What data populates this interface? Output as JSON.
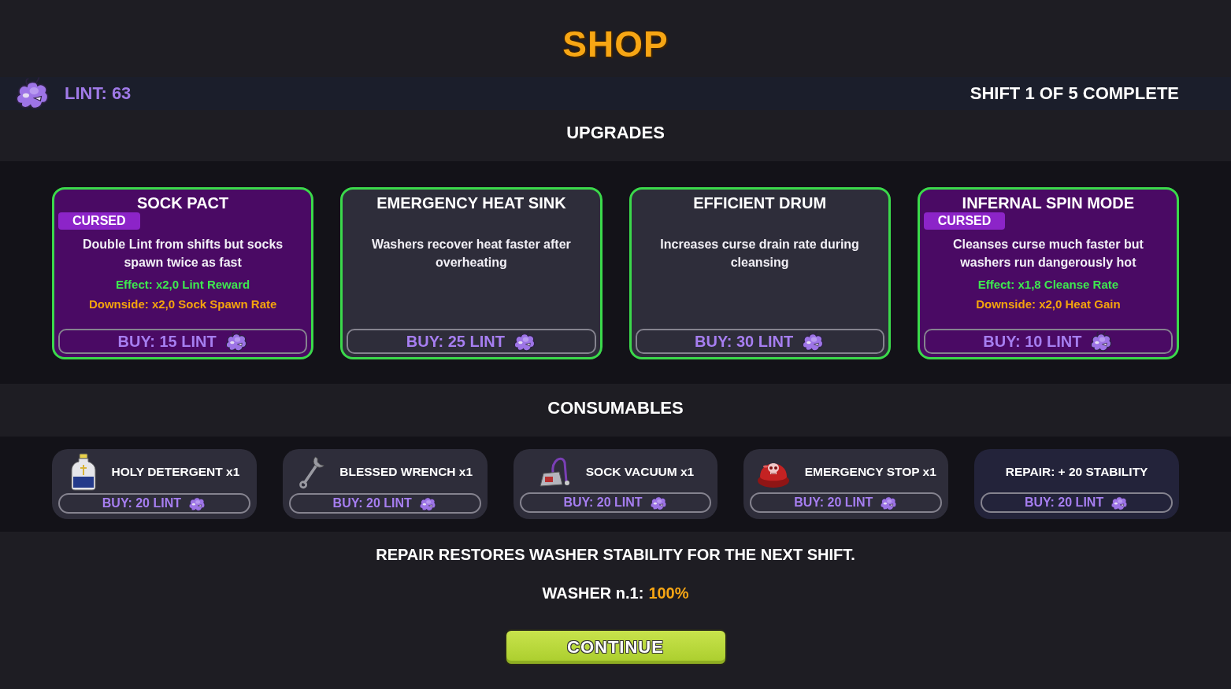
{
  "title": "SHOP",
  "status_bar": {
    "lint": "LINT: 63",
    "shift": "SHIFT 1 OF 5 COMPLETE"
  },
  "upgrades": {
    "heading": "UPGRADES",
    "cards": [
      {
        "name": "SOCK PACT",
        "cursed": true,
        "tag": "CURSED",
        "description": "Double Lint from shifts but socks spawn twice as fast",
        "effect": "Effect: x2,0 Lint Reward",
        "downside": "Downside: x2,0 Sock Spawn Rate",
        "price": "BUY: 15 LINT"
      },
      {
        "name": "EMERGENCY HEAT SINK",
        "cursed": false,
        "description": "Washers recover heat faster after overheating",
        "price": "BUY: 25 LINT"
      },
      {
        "name": "EFFICIENT DRUM",
        "cursed": false,
        "description": "Increases curse drain rate during cleansing",
        "price": "BUY: 30 LINT"
      },
      {
        "name": "INFERNAL SPIN MODE",
        "cursed": true,
        "tag": "CURSED",
        "description": "Cleanses curse much faster but washers run dangerously hot",
        "effect": "Effect: x1,8 Cleanse Rate",
        "downside": "Downside: x2,0 Heat Gain",
        "price": "BUY: 10 LINT"
      }
    ]
  },
  "consumables": {
    "heading": "CONSUMABLES",
    "items": [
      {
        "kind": "detergent",
        "name": "HOLY DETERGENT x1",
        "price": "BUY: 20 LINT"
      },
      {
        "kind": "wrench",
        "name": "BLESSED WRENCH x1",
        "price": "BUY: 20 LINT"
      },
      {
        "kind": "vacuum",
        "name": "SOCK VACUUM x1",
        "price": "BUY: 20 LINT"
      },
      {
        "kind": "stop",
        "name": "EMERGENCY STOP x1",
        "price": "BUY: 20 LINT"
      },
      {
        "kind": "repair",
        "name": "REPAIR: + 20 STABILITY",
        "price": "BUY: 20 LINT"
      }
    ]
  },
  "note": "REPAIR RESTORES WASHER STABILITY FOR THE NEXT SHIFT.",
  "washer": {
    "label": "WASHER n.1:",
    "value": "100%"
  },
  "continue_button": "CONTINUE"
}
